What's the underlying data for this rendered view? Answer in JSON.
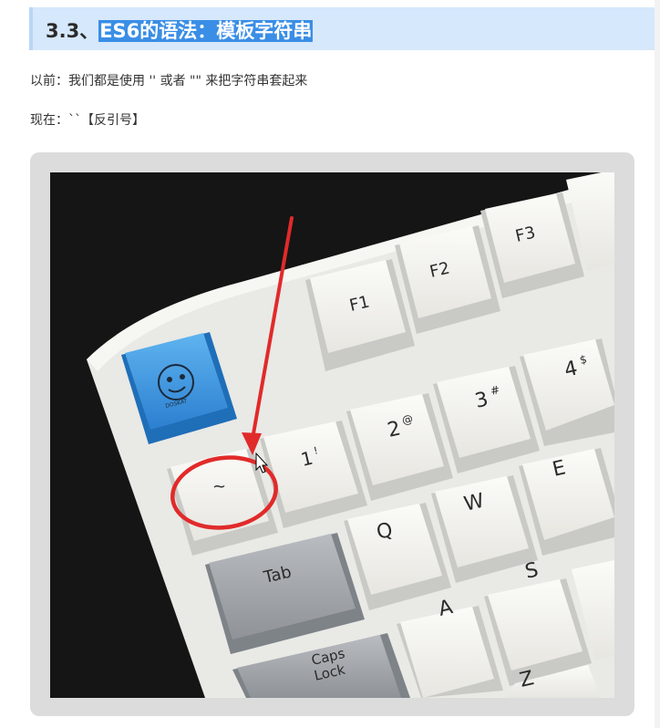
{
  "heading": {
    "prefix": "3.3、",
    "selected": "ES6的语法：模板字符串"
  },
  "paragraphs": {
    "before": "以前：我们都是使用   ''   或者  \"\"  来把字符串套起来",
    "now": "现在：``【反引号】"
  },
  "figure": {
    "keys": {
      "f1": "F1",
      "f2": "F2",
      "f3": "F3",
      "k1": "1",
      "k1_shift": "!",
      "k2": "2",
      "k2_shift": "@",
      "k3": "3",
      "k3_shift": "#",
      "k4": "4",
      "k4_shift": "$",
      "backtick": "~",
      "q": "Q",
      "w": "W",
      "e": "E",
      "a": "A",
      "s": "S",
      "z": "Z",
      "tab": "Tab",
      "caps_line1": "Caps",
      "caps_line2": "Lock",
      "logo_text": "DOSKAT"
    }
  }
}
